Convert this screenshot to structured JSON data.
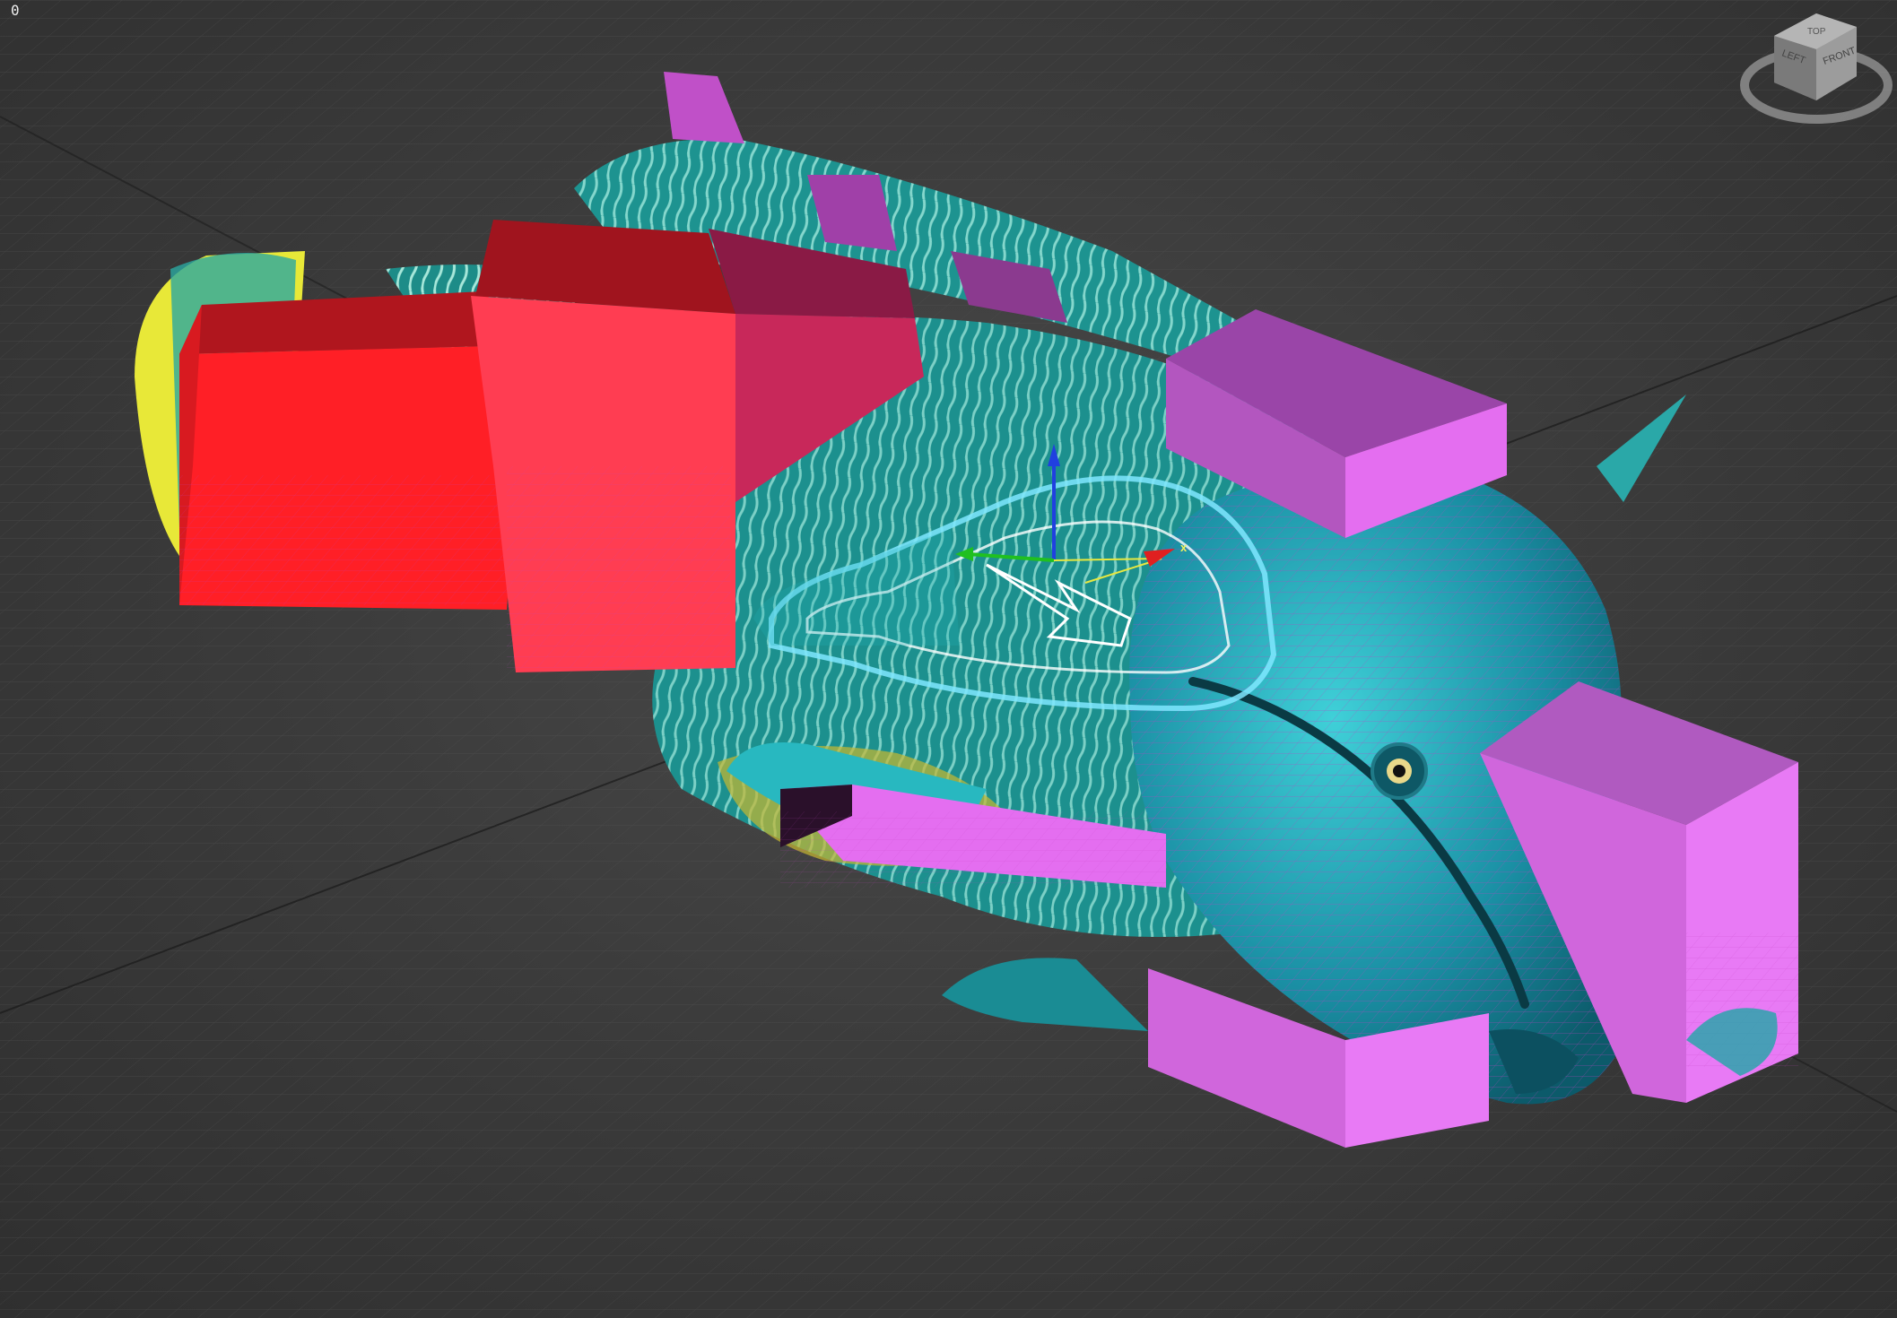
{
  "viewport": {
    "frame_counter": "0",
    "background_color": "#3c3c3c",
    "grid_color": "#5a5a5a"
  },
  "viewcube": {
    "face_front": "FRONT",
    "face_left": "LEFT",
    "face_top": "TOP"
  },
  "gizmo": {
    "x_label": "x",
    "x_color": "#e02020",
    "y_color": "#20c020",
    "z_color": "#2040e0"
  },
  "scene": {
    "model": "napoleon wrasse fish",
    "fish_color": "#1fa8a8",
    "tail_color": "#e8e838",
    "tail_boxes_color": "#ff2a2a",
    "mid_box_color": "#ff3d5a",
    "body_boxes_color": "#d75fd8",
    "selected_spline_color": "#7fe8ff",
    "wireframe_color": "#b020b0"
  }
}
